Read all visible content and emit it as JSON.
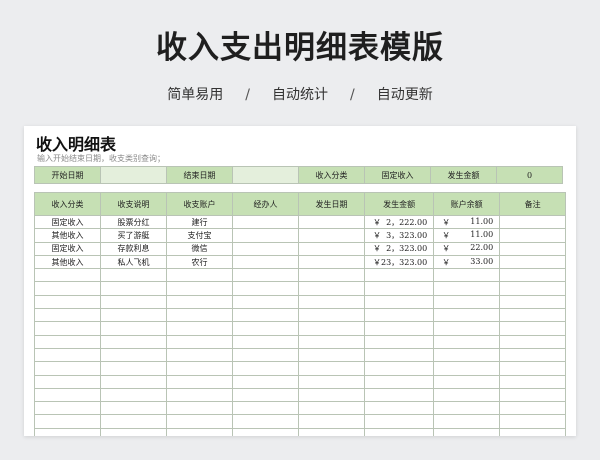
{
  "hero": {
    "title": "收入支出明细表模版",
    "tags": [
      "简单易用",
      "自动统计",
      "自动更新"
    ],
    "separator": "/"
  },
  "sheet": {
    "title": "收入明细表",
    "hint": "输入开始结束日期，收支类别查询；",
    "filter": {
      "start_label": "开始日期",
      "start_value": "",
      "end_label": "结束日期",
      "end_value": "",
      "category_label": "收入分类",
      "category_value": "固定收入",
      "amount_label": "发生金额",
      "amount_value": "0"
    },
    "columns": [
      "收入分类",
      "收支说明",
      "收支账户",
      "经办人",
      "发生日期",
      "发生金额",
      "账户余额",
      "备注"
    ],
    "currency": "￥",
    "rows": [
      {
        "category": "固定收入",
        "desc": "股票分红",
        "account": "建行",
        "handler": "",
        "date": "",
        "amount": "2，222.00",
        "balance": "11.00",
        "note": ""
      },
      {
        "category": "其他收入",
        "desc": "买了游艇",
        "account": "支付宝",
        "handler": "",
        "date": "",
        "amount": "3，323.00",
        "balance": "11.00",
        "note": ""
      },
      {
        "category": "固定收入",
        "desc": "存款利息",
        "account": "微信",
        "handler": "",
        "date": "",
        "amount": "2，323.00",
        "balance": "22.00",
        "note": ""
      },
      {
        "category": "其他收入",
        "desc": "私人飞机",
        "account": "农行",
        "handler": "",
        "date": "",
        "amount": "23，323.00",
        "balance": "33.00",
        "note": ""
      }
    ],
    "colors": {
      "header_green": "#c6e0b4",
      "grid": "#b9c4b5"
    }
  }
}
